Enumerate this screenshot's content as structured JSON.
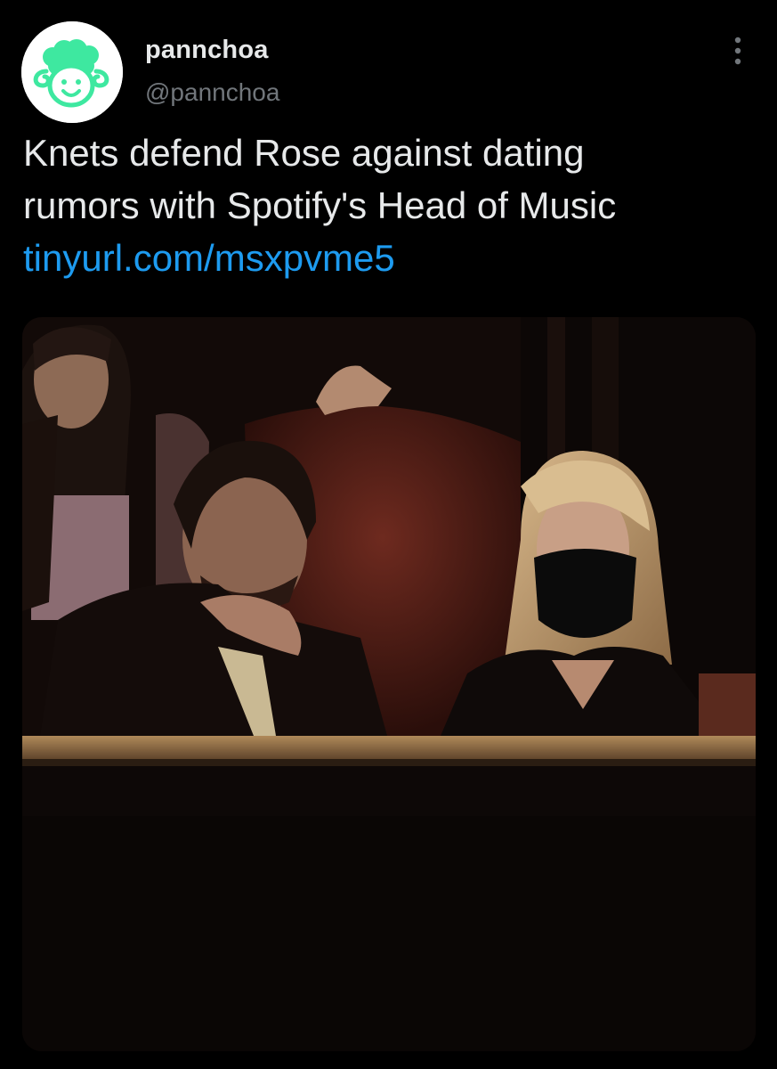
{
  "tweet": {
    "display_name": "pannchoa",
    "handle": "@pannchoa",
    "text_lines": [
      "Knets defend Rose against dating",
      "rumors with Spotify's Head of Music"
    ],
    "link": "tinyurl.com/msxpvme5"
  },
  "icons": {
    "avatar": "sheep-logo-icon",
    "more": "more-vertical-icon"
  },
  "colors": {
    "background": "#000000",
    "primary_text": "#e7e9ea",
    "secondary_text": "#71767b",
    "link": "#1d9bf0",
    "avatar_accent": "#3ee8a0"
  }
}
